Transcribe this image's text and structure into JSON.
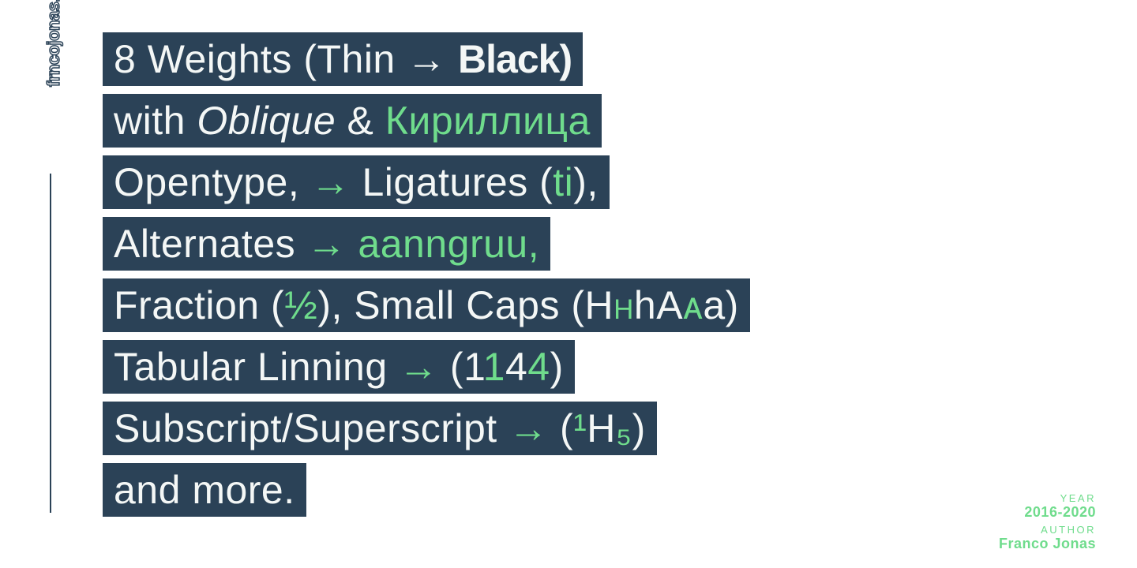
{
  "brand": "frncojonas.com",
  "content": {
    "l1": {
      "weights": "8 Weights ",
      "paren_open": "(",
      "thin": "Thin",
      "arrow1": " → ",
      "black": "Black",
      "paren_close": ")"
    },
    "l2": {
      "with": "with ",
      "oblique": "Oblique",
      "amp": " & ",
      "cyr": "Кириллица"
    },
    "l3": {
      "opentype": "Opentype, ",
      "arrow": "→",
      "ligatures": " Ligatures (",
      "ti": "ti",
      "close": "),"
    },
    "l4": {
      "alternates": "Alternates ",
      "arrow": "→",
      "sp": " ",
      "alts": "aanngruu,"
    },
    "l5": {
      "fraction": "Fraction (",
      "half": "½",
      "smcaps": "), Small Caps (H",
      "hsc": "н",
      "h2": "hA",
      "asc": "ᴀ",
      "a2": "a)"
    },
    "l6": {
      "tabular": "Tabular Linning ",
      "arrow": "→",
      "open": " (1",
      "one": "1",
      "four1": "4",
      "four2": "4",
      "close": ")"
    },
    "l7": {
      "subsup": "Subscript/Superscript ",
      "arrow": "→",
      "open": " (",
      "sup1": "¹",
      "h": "H",
      "sub5": "₅",
      "close": ")"
    },
    "l8": {
      "more": "and more."
    }
  },
  "meta": {
    "year_label": "Year",
    "year_value": "2016-2020",
    "author_label": "Author",
    "author_value": "Franco Jonas"
  }
}
